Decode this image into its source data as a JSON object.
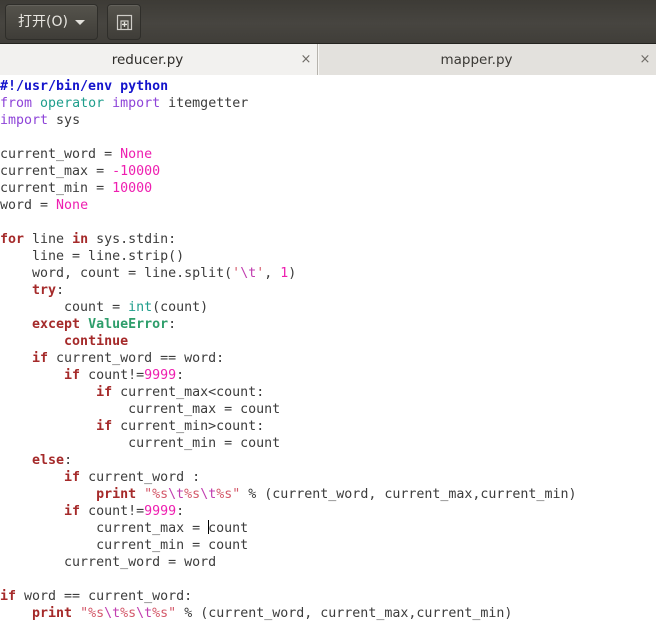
{
  "toolbar": {
    "open_button_label": "打开(O)",
    "open_button_icon": "chevron-down-icon",
    "new_tab_button_icon": "new-document-icon",
    "background_color": "#474540"
  },
  "tabs": [
    {
      "label": "reducer.py",
      "close_label": "×",
      "active": true
    },
    {
      "label": "mapper.py",
      "close_label": "×",
      "active": false
    }
  ],
  "editor": {
    "filename": "reducer.py",
    "language": "python",
    "colors": {
      "background": "#ffffff",
      "text": "#3c3c3c",
      "keyword": "#a52a2a",
      "import": "#8e44d8",
      "module": "#1f9e8c",
      "exception": "#2e9e6b",
      "number": "#ee1fb0",
      "string": "#d4596a",
      "escape": "#c13fb0",
      "shebang": "#1414cc"
    },
    "lines": [
      "#!/usr/bin/env python",
      "from operator import itemgetter",
      "import sys",
      "",
      "current_word = None",
      "current_max = -10000",
      "current_min = 10000",
      "word = None",
      "",
      "for line in sys.stdin:",
      "    line = line.strip()",
      "    word, count = line.split('\\t', 1)",
      "    try:",
      "        count = int(count)",
      "    except ValueError:",
      "        continue",
      "    if current_word == word:",
      "        if count!=9999:",
      "            if current_max<count:",
      "                current_max = count",
      "            if current_min>count:",
      "                current_min = count",
      "    else:",
      "        if current_word :",
      "            print \"%s\\t%s\\t%s\" % (current_word, current_max,current_min)",
      "        if count!=9999:",
      "            current_max = count",
      "            current_min = count",
      "        current_word = word",
      "",
      "if word == current_word:",
      "    print \"%s\\t%s\\t%s\" % (current_word, current_max,current_min)"
    ],
    "cursor": {
      "line": 26,
      "column": 26,
      "description": "text caret before 'count' on 'current_max = count'"
    }
  }
}
